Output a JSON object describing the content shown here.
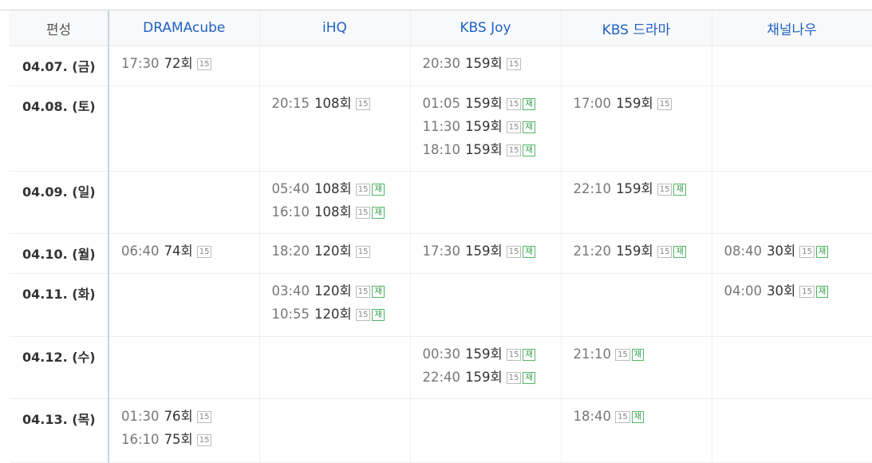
{
  "header": {
    "corner": "편성",
    "channels": [
      "DRAMAcube",
      "iHQ",
      "KBS Joy",
      "KBS 드라마",
      "채널나우"
    ]
  },
  "rows": [
    {
      "date": "04.07. (금)",
      "cells": [
        [
          {
            "time": "17:30",
            "ep": "72회",
            "rating": "15",
            "rerun": ""
          }
        ],
        [],
        [
          {
            "time": "20:30",
            "ep": "159회",
            "rating": "15",
            "rerun": ""
          }
        ],
        [],
        []
      ]
    },
    {
      "date": "04.08. (토)",
      "cells": [
        [],
        [
          {
            "time": "20:15",
            "ep": "108회",
            "rating": "15",
            "rerun": ""
          }
        ],
        [
          {
            "time": "01:05",
            "ep": "159회",
            "rating": "15",
            "rerun": "재"
          },
          {
            "time": "11:30",
            "ep": "159회",
            "rating": "15",
            "rerun": "재"
          },
          {
            "time": "18:10",
            "ep": "159회",
            "rating": "15",
            "rerun": "재"
          }
        ],
        [
          {
            "time": "17:00",
            "ep": "159회",
            "rating": "15",
            "rerun": ""
          }
        ],
        []
      ]
    },
    {
      "date": "04.09. (일)",
      "cells": [
        [],
        [
          {
            "time": "05:40",
            "ep": "108회",
            "rating": "15",
            "rerun": "재"
          },
          {
            "time": "16:10",
            "ep": "108회",
            "rating": "15",
            "rerun": "재"
          }
        ],
        [],
        [
          {
            "time": "22:10",
            "ep": "159회",
            "rating": "15",
            "rerun": "재"
          }
        ],
        []
      ]
    },
    {
      "date": "04.10. (월)",
      "cells": [
        [
          {
            "time": "06:40",
            "ep": "74회",
            "rating": "15",
            "rerun": ""
          }
        ],
        [
          {
            "time": "18:20",
            "ep": "120회",
            "rating": "15",
            "rerun": ""
          }
        ],
        [
          {
            "time": "17:30",
            "ep": "159회",
            "rating": "15",
            "rerun": "재"
          }
        ],
        [
          {
            "time": "21:20",
            "ep": "159회",
            "rating": "15",
            "rerun": "재"
          }
        ],
        [
          {
            "time": "08:40",
            "ep": "30회",
            "rating": "15",
            "rerun": "재"
          }
        ]
      ]
    },
    {
      "date": "04.11. (화)",
      "cells": [
        [],
        [
          {
            "time": "03:40",
            "ep": "120회",
            "rating": "15",
            "rerun": "재"
          },
          {
            "time": "10:55",
            "ep": "120회",
            "rating": "15",
            "rerun": "재"
          }
        ],
        [],
        [],
        [
          {
            "time": "04:00",
            "ep": "30회",
            "rating": "15",
            "rerun": "재"
          }
        ]
      ]
    },
    {
      "date": "04.12. (수)",
      "cells": [
        [],
        [],
        [
          {
            "time": "00:30",
            "ep": "159회",
            "rating": "15",
            "rerun": "재"
          },
          {
            "time": "22:40",
            "ep": "159회",
            "rating": "15",
            "rerun": "재"
          }
        ],
        [
          {
            "time": "21:10",
            "ep": "",
            "rating": "15",
            "rerun": "재"
          }
        ],
        []
      ]
    },
    {
      "date": "04.13. (목)",
      "cells": [
        [
          {
            "time": "01:30",
            "ep": "76회",
            "rating": "15",
            "rerun": ""
          },
          {
            "time": "16:10",
            "ep": "75회",
            "rating": "15",
            "rerun": ""
          }
        ],
        [],
        [],
        [
          {
            "time": "18:40",
            "ep": "",
            "rating": "15",
            "rerun": "재"
          }
        ],
        []
      ]
    }
  ]
}
